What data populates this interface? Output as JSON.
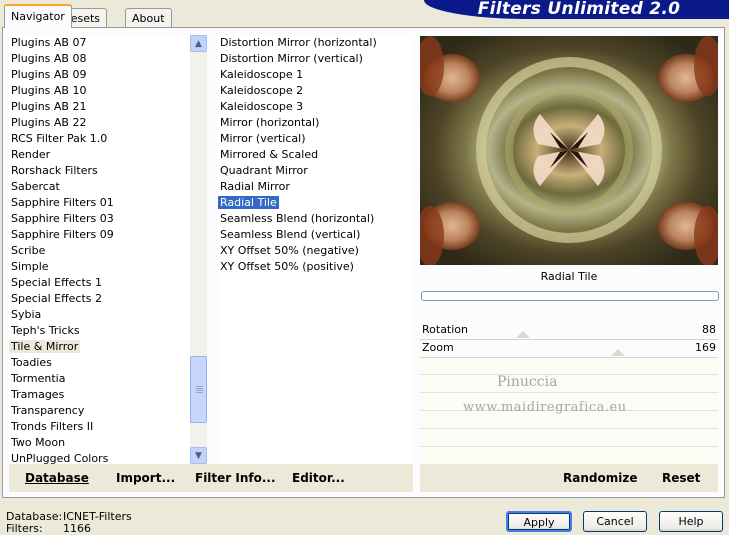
{
  "tabs": [
    {
      "label": "Navigator",
      "active": true
    },
    {
      "label": "Presets",
      "active": false
    },
    {
      "label": "About",
      "active": false
    }
  ],
  "banner_title": "Filters Unlimited 2.0",
  "categories": {
    "items": [
      "Plugins AB 07",
      "Plugins AB 08",
      "Plugins AB 09",
      "Plugins AB 10",
      "Plugins AB 21",
      "Plugins AB 22",
      "RCS Filter Pak 1.0",
      "Render",
      "Rorshack Filters",
      "Sabercat",
      "Sapphire Filters 01",
      "Sapphire Filters 03",
      "Sapphire Filters 09",
      "Scribe",
      "Simple",
      "Special Effects 1",
      "Special Effects 2",
      "Sybia",
      "Teph's Tricks",
      "Tile & Mirror",
      "Toadies",
      "Tormentia",
      "Tramages",
      "Transparency",
      "Tronds Filters II",
      "Two Moon",
      "UnPlugged Colors"
    ],
    "selected": "Tile & Mirror"
  },
  "filters": {
    "items": [
      "Distortion Mirror (horizontal)",
      "Distortion Mirror (vertical)",
      "Kaleidoscope 1",
      "Kaleidoscope 2",
      "Kaleidoscope 3",
      "Mirror (horizontal)",
      "Mirror (vertical)",
      "Mirrored & Scaled",
      "Quadrant Mirror",
      "Radial Mirror",
      "Radial Tile",
      "Seamless Blend (horizontal)",
      "Seamless Blend (vertical)",
      "XY Offset 50% (negative)",
      "XY Offset 50% (positive)"
    ],
    "selected": "Radial Tile"
  },
  "preview": {
    "filter_name": "Radial Tile"
  },
  "parameters": [
    {
      "label": "Rotation",
      "value": "88"
    },
    {
      "label": "Zoom",
      "value": "169"
    }
  ],
  "watermark": {
    "line1": "Pinuccia",
    "line2": "www.maidiregrafica.eu"
  },
  "left_buttons": {
    "database": "Database",
    "import": "Import...",
    "filter_info": "Filter Info...",
    "editor": "Editor..."
  },
  "right_buttons": {
    "randomize": "Randomize",
    "reset": "Reset"
  },
  "status": {
    "database_label": "Database:",
    "database_value": "ICNET-Filters",
    "filters_label": "Filters:",
    "filters_value": "1166"
  },
  "dialog_buttons": {
    "apply": "Apply",
    "cancel": "Cancel",
    "help": "Help"
  }
}
